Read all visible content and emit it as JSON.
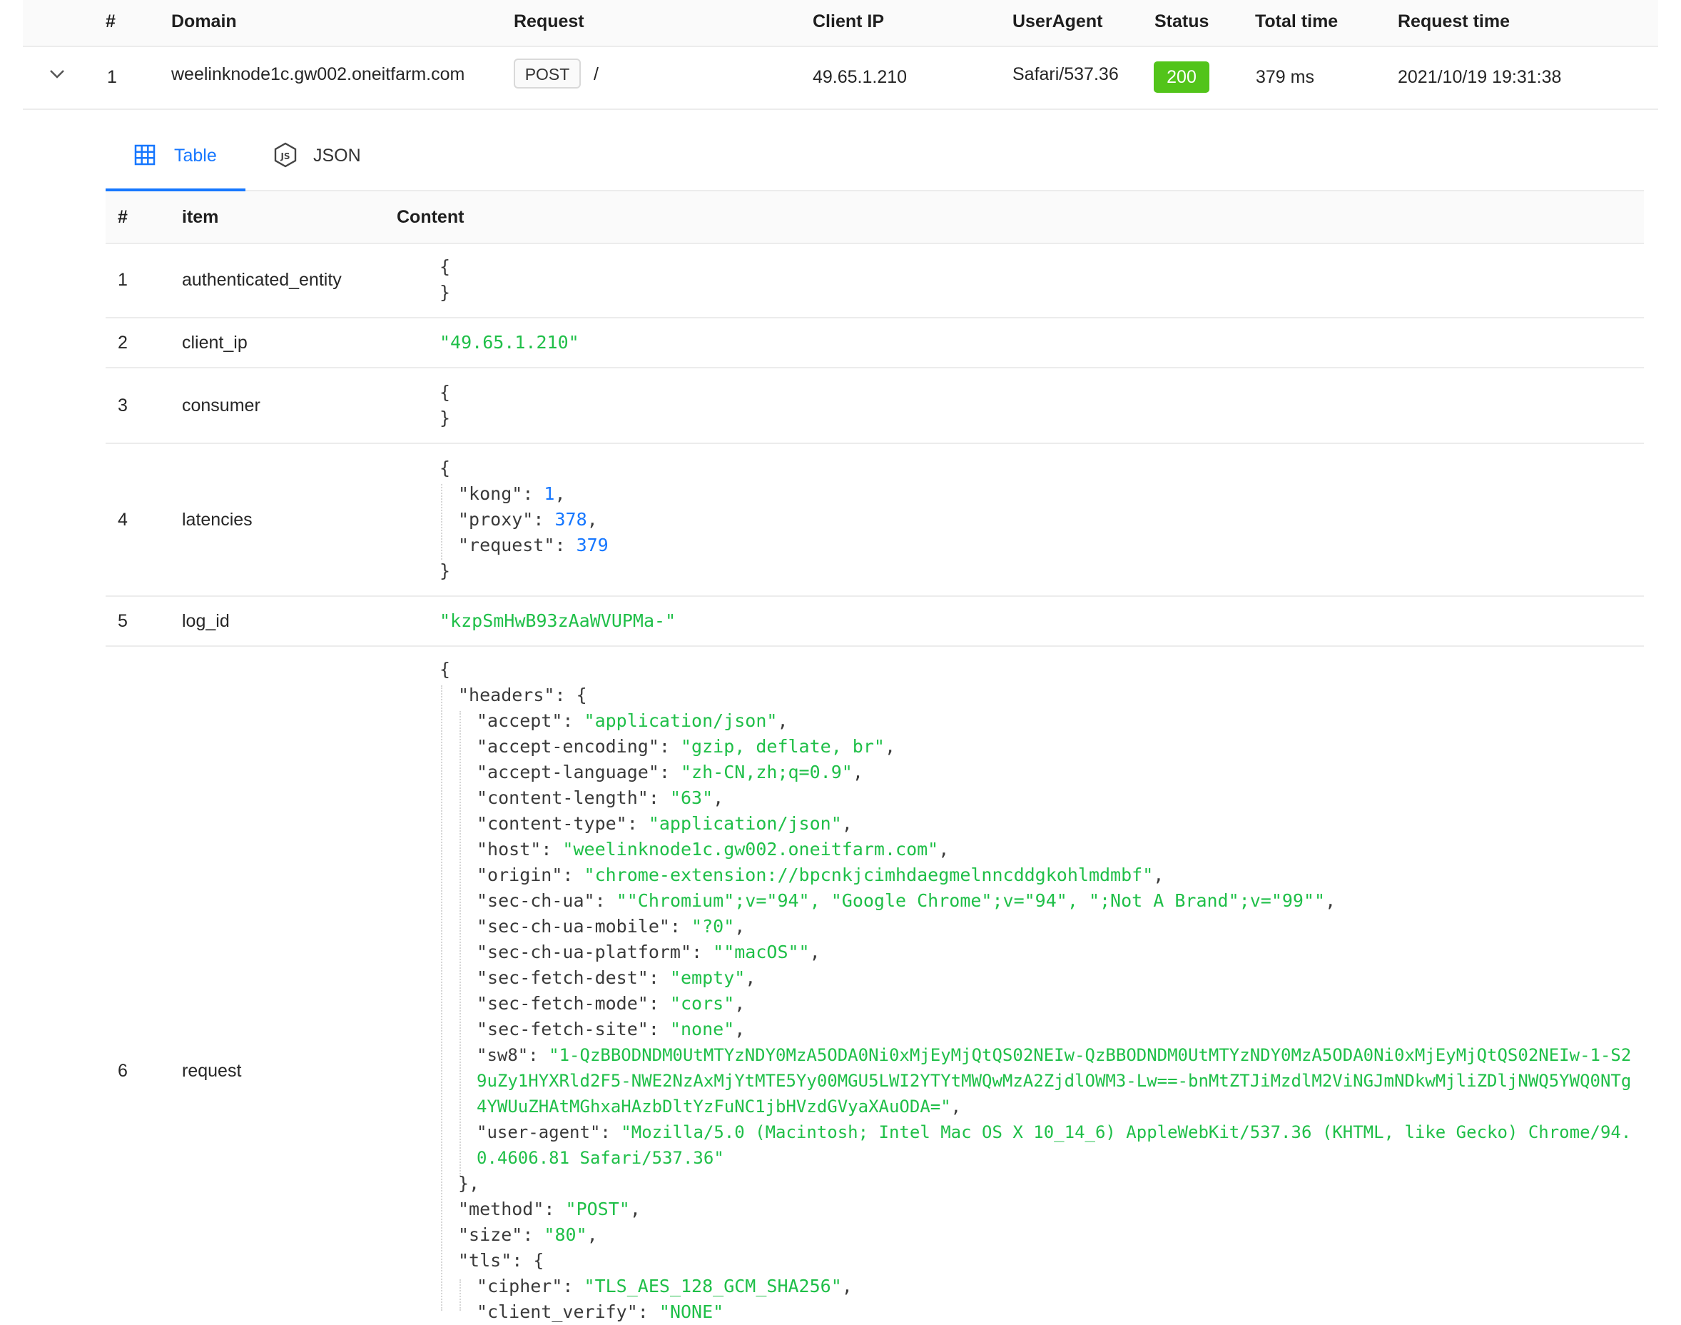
{
  "top_table": {
    "headers": [
      "#",
      "Domain",
      "Request",
      "Client IP",
      "UserAgent",
      "Status",
      "Total time",
      "Request time"
    ],
    "row": {
      "index": "1",
      "domain": "weelinknode1c.gw002.oneitfarm.com",
      "method": "POST",
      "path": "/",
      "client_ip": "49.65.1.210",
      "user_agent": "Safari/537.36",
      "status": "200",
      "total_time": "379 ms",
      "request_time": "2021/10/19 19:31:38"
    }
  },
  "tabs": [
    {
      "label": "Table",
      "icon": "table-grid-icon",
      "active": true
    },
    {
      "label": "JSON",
      "icon": "js-icon",
      "active": false
    }
  ],
  "detail_table": {
    "headers": [
      "#",
      "item",
      "Content"
    ],
    "rows": [
      {
        "index": "1",
        "item": "authenticated_entity"
      },
      {
        "index": "2",
        "item": "client_ip",
        "value": "\"49.65.1.210\""
      },
      {
        "index": "3",
        "item": "consumer"
      },
      {
        "index": "4",
        "item": "latencies"
      },
      {
        "index": "5",
        "item": "log_id",
        "value": "\"kzpSmHwB93zAaWVUPMa-\""
      },
      {
        "index": "6",
        "item": "request"
      }
    ]
  },
  "latencies": [
    {
      "key": "\"kong\"",
      "value": "1"
    },
    {
      "key": "\"proxy\"",
      "value": "378"
    },
    {
      "key": "\"request\"",
      "value": "379"
    }
  ],
  "request": {
    "headers_key": "\"headers\"",
    "headers": [
      {
        "key": "\"accept\"",
        "value": "\"application/json\""
      },
      {
        "key": "\"accept-encoding\"",
        "value": "\"gzip, deflate, br\""
      },
      {
        "key": "\"accept-language\"",
        "value": "\"zh-CN,zh;q=0.9\""
      },
      {
        "key": "\"content-length\"",
        "value": "\"63\""
      },
      {
        "key": "\"content-type\"",
        "value": "\"application/json\""
      },
      {
        "key": "\"host\"",
        "value": "\"weelinknode1c.gw002.oneitfarm.com\""
      },
      {
        "key": "\"origin\"",
        "value": "\"chrome-extension://bpcnkjcimhdaegmelnncddgkohlmdmbf\""
      },
      {
        "key": "\"sec-ch-ua\"",
        "value": "\"\"Chromium\";v=\"94\", \"Google Chrome\";v=\"94\", \";Not A Brand\";v=\"99\"\""
      },
      {
        "key": "\"sec-ch-ua-mobile\"",
        "value": "\"?0\""
      },
      {
        "key": "\"sec-ch-ua-platform\"",
        "value": "\"\"macOS\"\""
      },
      {
        "key": "\"sec-fetch-dest\"",
        "value": "\"empty\""
      },
      {
        "key": "\"sec-fetch-mode\"",
        "value": "\"cors\""
      },
      {
        "key": "\"sec-fetch-site\"",
        "value": "\"none\""
      }
    ],
    "sw8_key": "\"sw8\"",
    "sw8_line1": "\"1-QzBBODNDM0UtMTYzNDY0MzA5ODA0Ni0xMjEyMjQtQS02NEIw-QzBBODNDM0UtMTYzNDY0MzA5ODA0Ni0xMjEyMjQtQS02NEIw-1-S2",
    "sw8_line2": "9uZy1HYXRld2F5-NWE2NzAxMjYtMTE5Yy00MGU5LWI2YTYtMWQwMzA2ZjdlOWM3-Lw==-bnMtZTJiMzdlM2ViNGJmNDkwMjliZDljNWQ5YWQ0NTg",
    "sw8_line3": "4YWUuZHAtMGhxaHAzbDltYzFuNC1jbHVzdGVyaXAuODA=\"",
    "ua_key": "\"user-agent\"",
    "ua_line1": "\"Mozilla/5.0 (Macintosh; Intel Mac OS X 10_14_6) AppleWebKit/537.36 (KHTML, like Gecko) Chrome/94.",
    "ua_line2": "0.4606.81 Safari/537.36\"",
    "method_key": "\"method\"",
    "method_value": "\"POST\"",
    "size_key": "\"size\"",
    "size_value": "\"80\"",
    "tls_key": "\"tls\"",
    "cipher_key": "\"cipher\"",
    "cipher_value": "\"TLS_AES_128_GCM_SHA256\"",
    "client_verify_key": "\"client_verify\"",
    "client_verify_value": "\"NONE\""
  },
  "colors": {
    "accent": "#1677ff",
    "string": "#1fbf48",
    "number": "#1677ff",
    "status_ok": "#52c41a"
  }
}
